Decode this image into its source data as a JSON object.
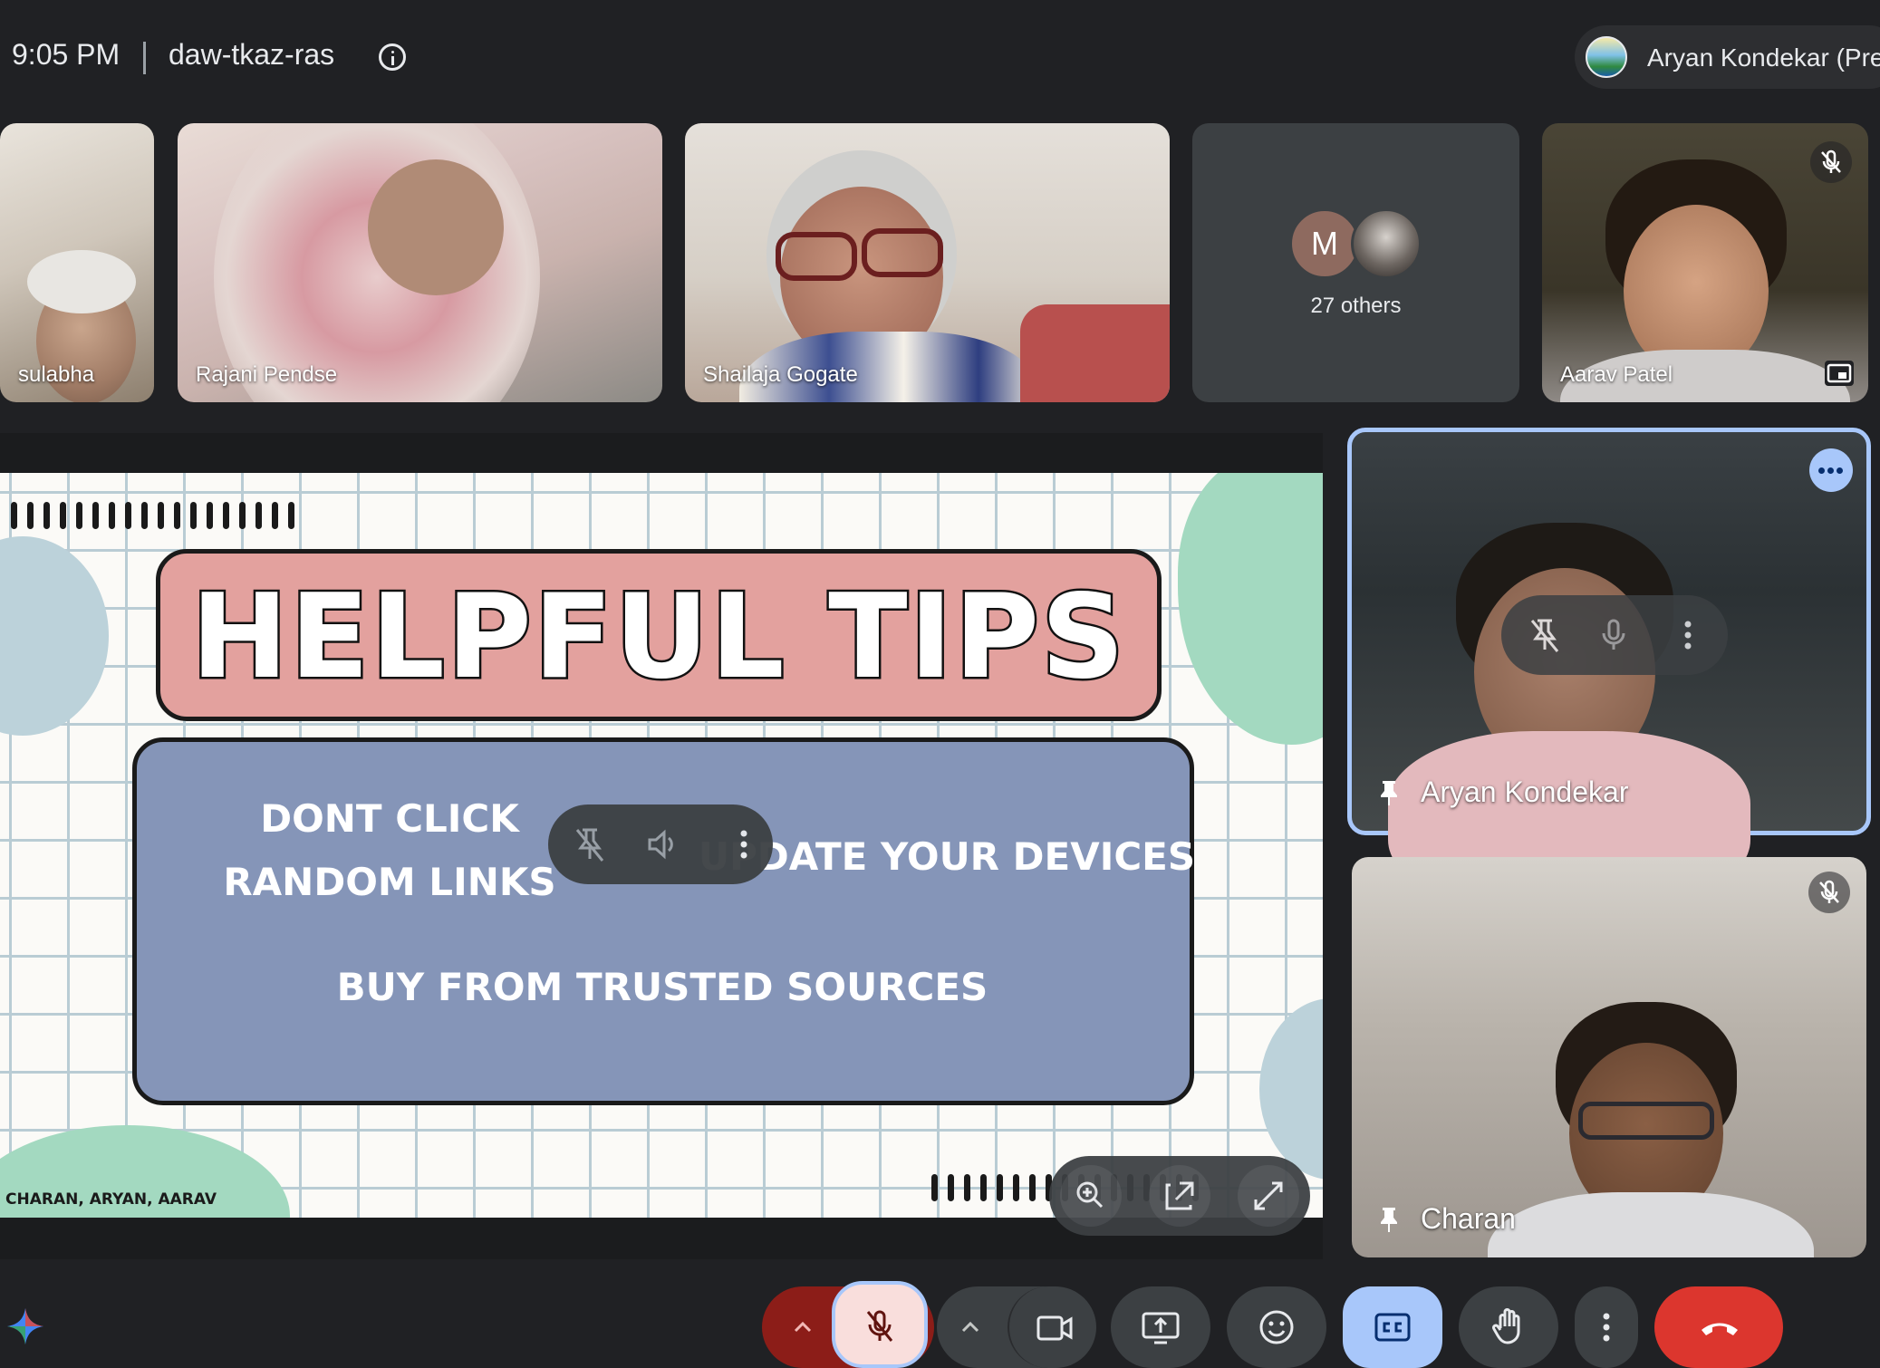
{
  "meeting": {
    "time": "9:05 PM",
    "code": "daw-tkaz-ras"
  },
  "presenter_chip": {
    "name": "Aryan Kondekar (Pre"
  },
  "filmstrip": {
    "tiles": [
      {
        "name": "sulabha"
      },
      {
        "name": "Rajani Pendse"
      },
      {
        "name": "Shailaja Gogate"
      },
      {
        "name": "27 others",
        "avatar_letter": "M"
      },
      {
        "name": "Aarav Patel",
        "muted": true
      }
    ]
  },
  "slide": {
    "title": "HELPFUL TIPS",
    "tips": [
      "DONT CLICK",
      "RANDOM LINKS",
      "UPDATE YOUR DEVICES",
      "BUY FROM TRUSTED SOURCES"
    ],
    "credit": "CHARAN, ARYAN, AARAV",
    "colors": {
      "title_box": "#e3a19e",
      "body_box": "#8595b8",
      "blob_green": "#a3d9c0",
      "blob_blue": "#bcd2da"
    }
  },
  "pinned_tiles": [
    {
      "name": "Aryan Kondekar",
      "pinned": true,
      "selected": true
    },
    {
      "name": "Charan",
      "pinned": true,
      "muted": true
    }
  ],
  "controls": {
    "buttons": [
      "mic-options",
      "microphone-muted",
      "camera-options",
      "camera",
      "present-screen",
      "reactions",
      "captions",
      "raise-hand",
      "more-options",
      "leave-call"
    ],
    "colors": {
      "mic_muted_bg": "#f9dedc",
      "captions_bg": "#a8c7fa",
      "leave_bg": "#dc362e",
      "mic_option_bg": "#8c1d18"
    }
  }
}
